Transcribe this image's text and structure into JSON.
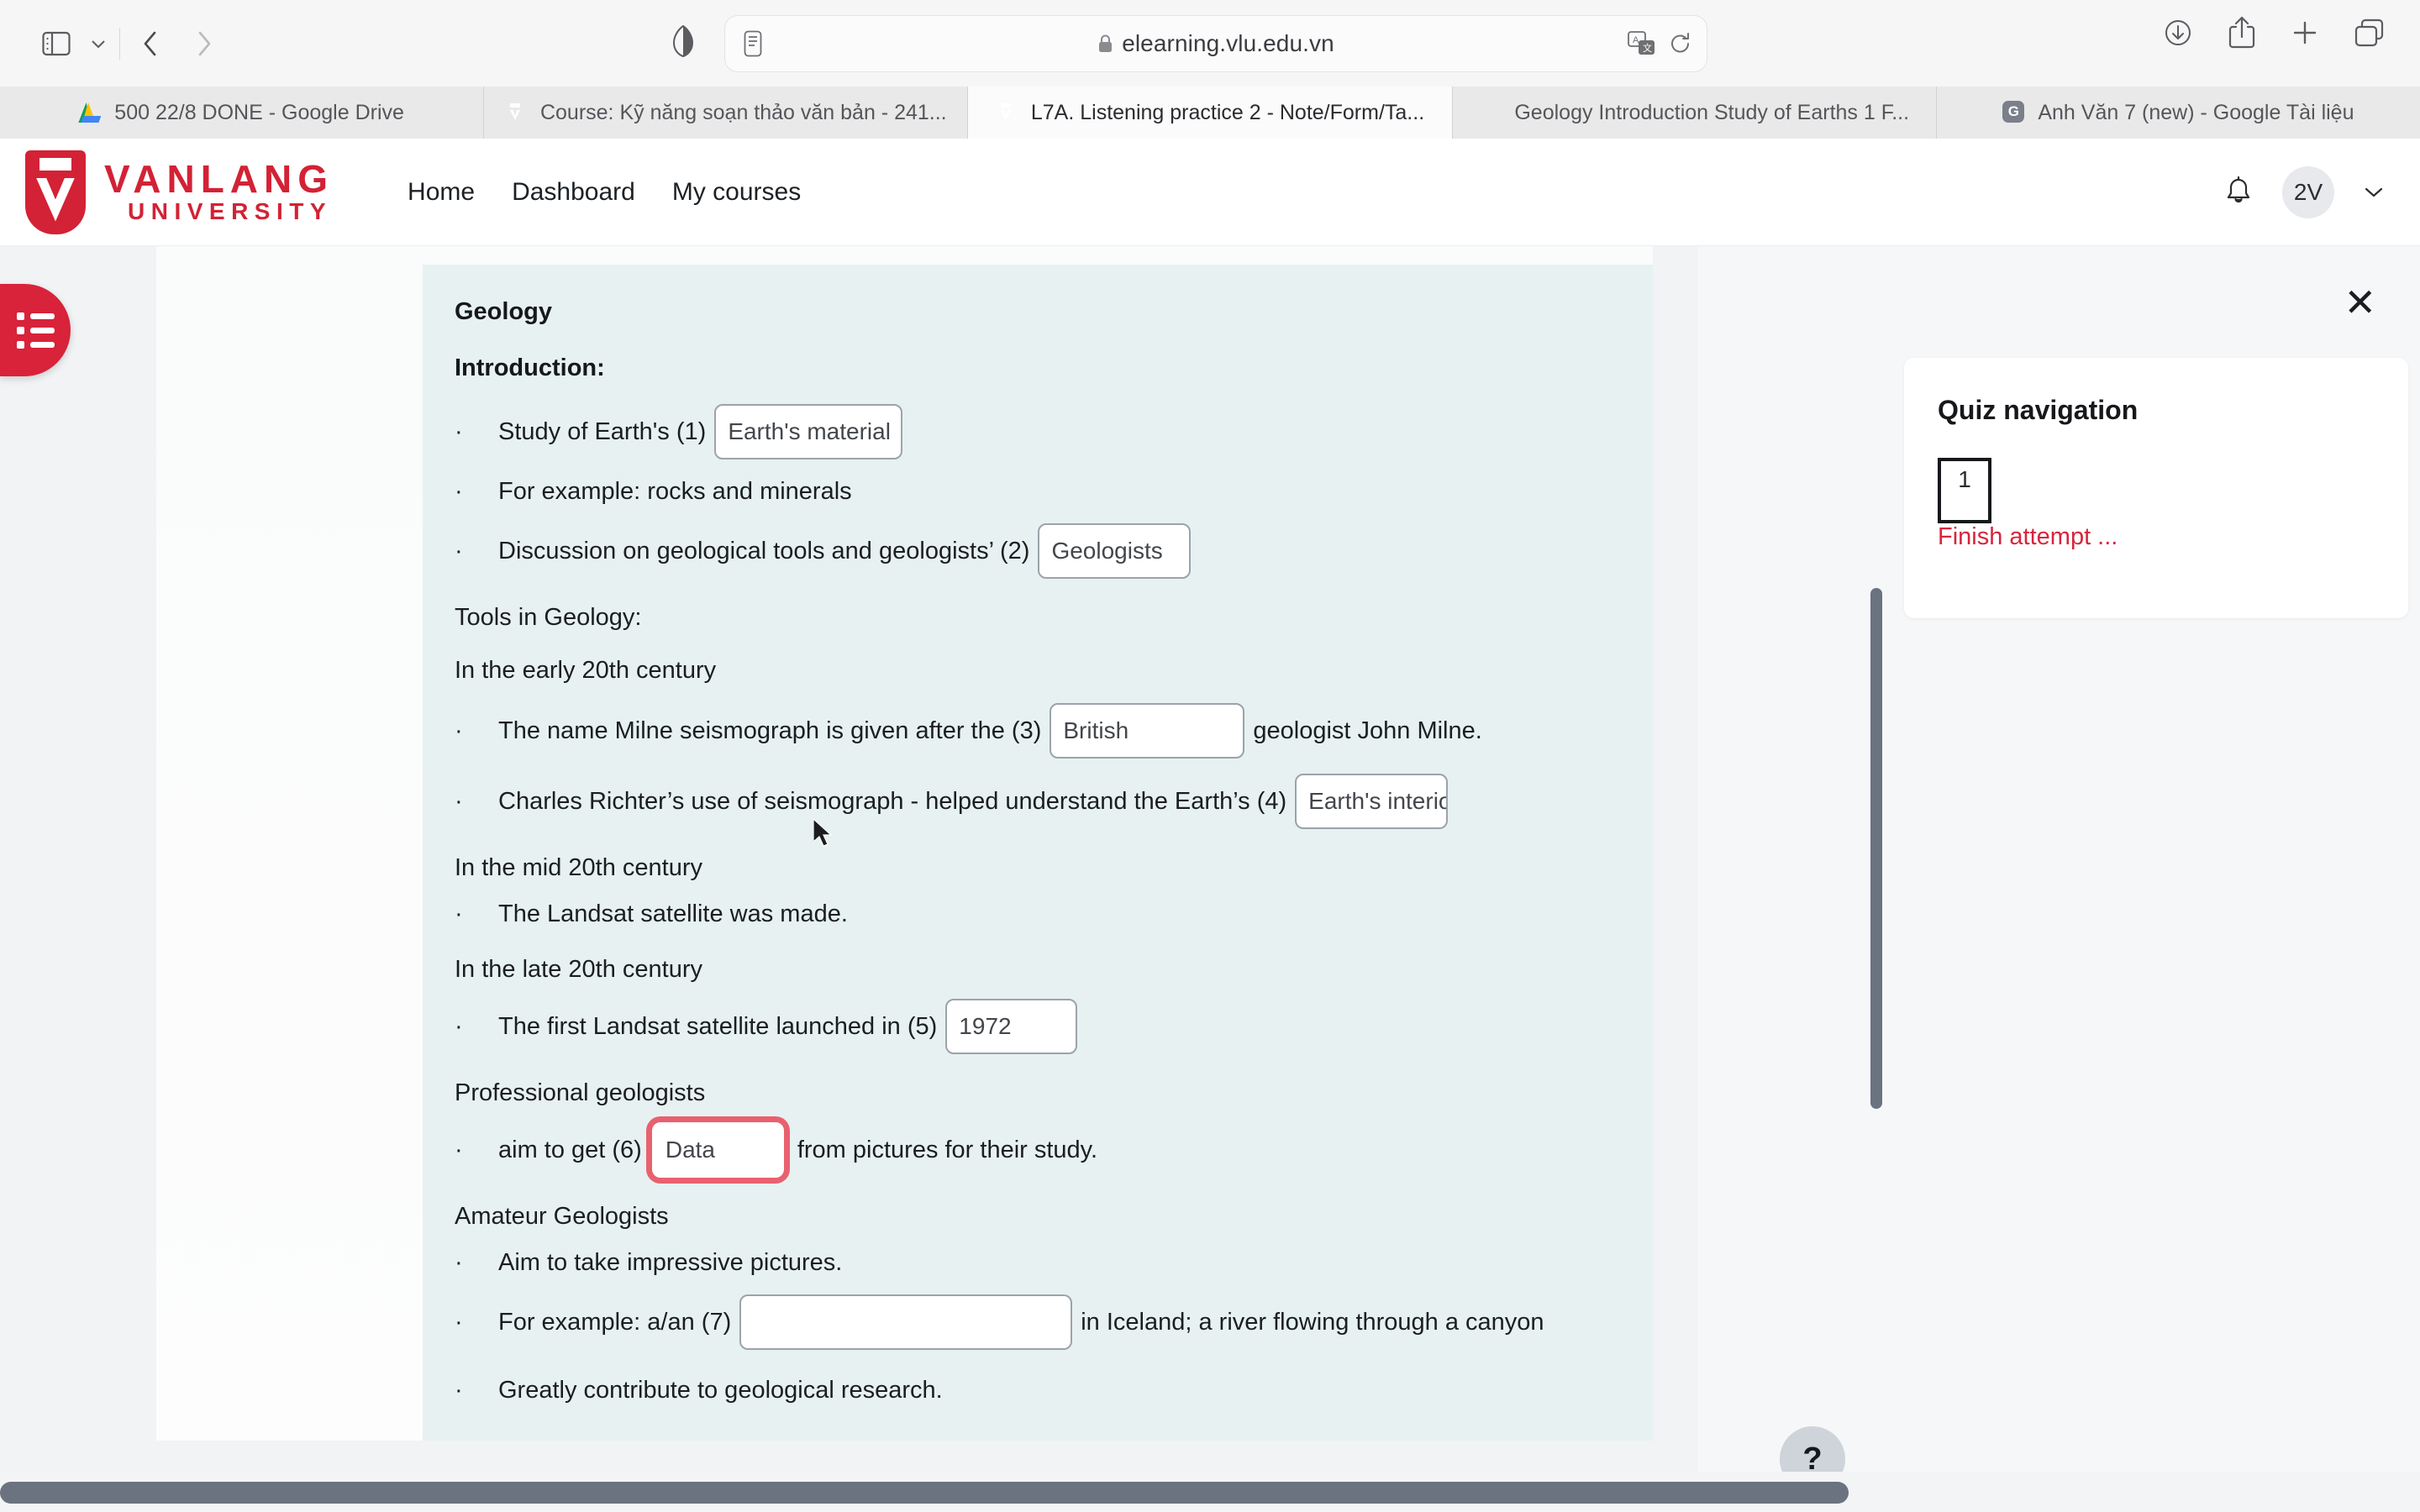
{
  "browser": {
    "url": "elearning.vlu.edu.vn",
    "lock_icon": "lock-icon",
    "toolbar_icons": [
      "sidebar-icon",
      "sidebar-dropdown-icon",
      "back-icon",
      "forward-icon",
      "shield-icon",
      "reader-icon",
      "translate-icon",
      "reload-icon",
      "downloads-icon",
      "share-icon",
      "new-tab-icon",
      "tab-overview-icon"
    ],
    "tabs": [
      {
        "label": "500 22/8 DONE - Google Drive",
        "favicon": "google-drive-icon",
        "active": false
      },
      {
        "label": "Course: Kỹ năng soạn thảo văn bản - 241...",
        "favicon": "vanlang-icon",
        "active": false
      },
      {
        "label": "L7A. Listening practice 2 - Note/Form/Ta...",
        "favicon": "vanlang-icon",
        "active": true
      },
      {
        "label": "Geology Introduction Study of Earths 1 F...",
        "favicon": "geology-icon",
        "active": false
      },
      {
        "label": "Anh Văn 7 (new) - Google Tài liệu",
        "favicon": "google-docs-icon",
        "active": false
      }
    ]
  },
  "site_header": {
    "logo_top": "VANLANG",
    "logo_bottom": "UNIVERSITY",
    "nav": [
      "Home",
      "Dashboard",
      "My courses"
    ],
    "bell_icon": "notification-bell-icon",
    "avatar_initials": "2V",
    "chevron_icon": "chevron-down-icon",
    "brand_color": "#d32235"
  },
  "drawer": {
    "icon": "course-index-list-icon"
  },
  "quiz": {
    "title": "Geology",
    "intro_heading": "Introduction:",
    "lines": [
      {
        "bullet": "·",
        "before": "Study of Earth's (1)",
        "answer": "Earth's material",
        "after": "",
        "size": "w-big"
      },
      {
        "bullet": "·",
        "before": "For example:  rocks and minerals",
        "answer": null,
        "after": "",
        "size": ""
      },
      {
        "bullet": "·",
        "before": "Discussion on geological tools and geologists’ (2)",
        "answer": "Geologists",
        "after": "",
        "size": "w-med"
      }
    ],
    "tools_heading": "Tools in Geology:",
    "early_heading": "In the early 20th century",
    "early_lines": [
      {
        "bullet": "·",
        "before": "The name Milne seismograph is given after the (3)",
        "answer": "British",
        "after": "geologist John Milne.",
        "size": "w-xl"
      },
      {
        "bullet": "·",
        "before": "Charles Richter’s use of seismograph - helped understand the Earth’s (4)",
        "answer": "Earth's interior",
        "after": "",
        "size": "w-med"
      }
    ],
    "mid_heading": "In the mid 20th century",
    "mid_lines": [
      {
        "bullet": "·",
        "before": "The Landsat satellite was made.",
        "answer": null,
        "after": "",
        "size": ""
      }
    ],
    "late_heading": "In the late 20th century",
    "late_lines": [
      {
        "bullet": "·",
        "before": "The first Landsat satellite launched in (5)",
        "answer": "1972",
        "after": "",
        "size": "w-sm"
      }
    ],
    "prof_heading": "Professional geologists",
    "prof_lines": [
      {
        "bullet": "·",
        "before": "aim to get (6)",
        "answer": "Data",
        "after": "from pictures for their study.",
        "size": "focused"
      }
    ],
    "amateur_heading": "Amateur Geologists",
    "amateur_lines": [
      {
        "bullet": "·",
        "before": "Aim to take impressive pictures.",
        "answer": null,
        "after": "",
        "size": ""
      },
      {
        "bullet": "·",
        "before": "For example: a/an (7)",
        "answer": "",
        "after": "in Iceland; a river flowing through a canyon",
        "size": "empty"
      },
      {
        "bullet": "·",
        "before": "Greatly contribute to geological research.",
        "answer": null,
        "after": "",
        "size": ""
      }
    ]
  },
  "quiz_nav": {
    "close_label": "✕",
    "title": "Quiz navigation",
    "question_numbers": [
      "1"
    ],
    "finish_label": "Finish attempt ...",
    "link_color": "#d8243c"
  },
  "help": {
    "label": "?"
  }
}
